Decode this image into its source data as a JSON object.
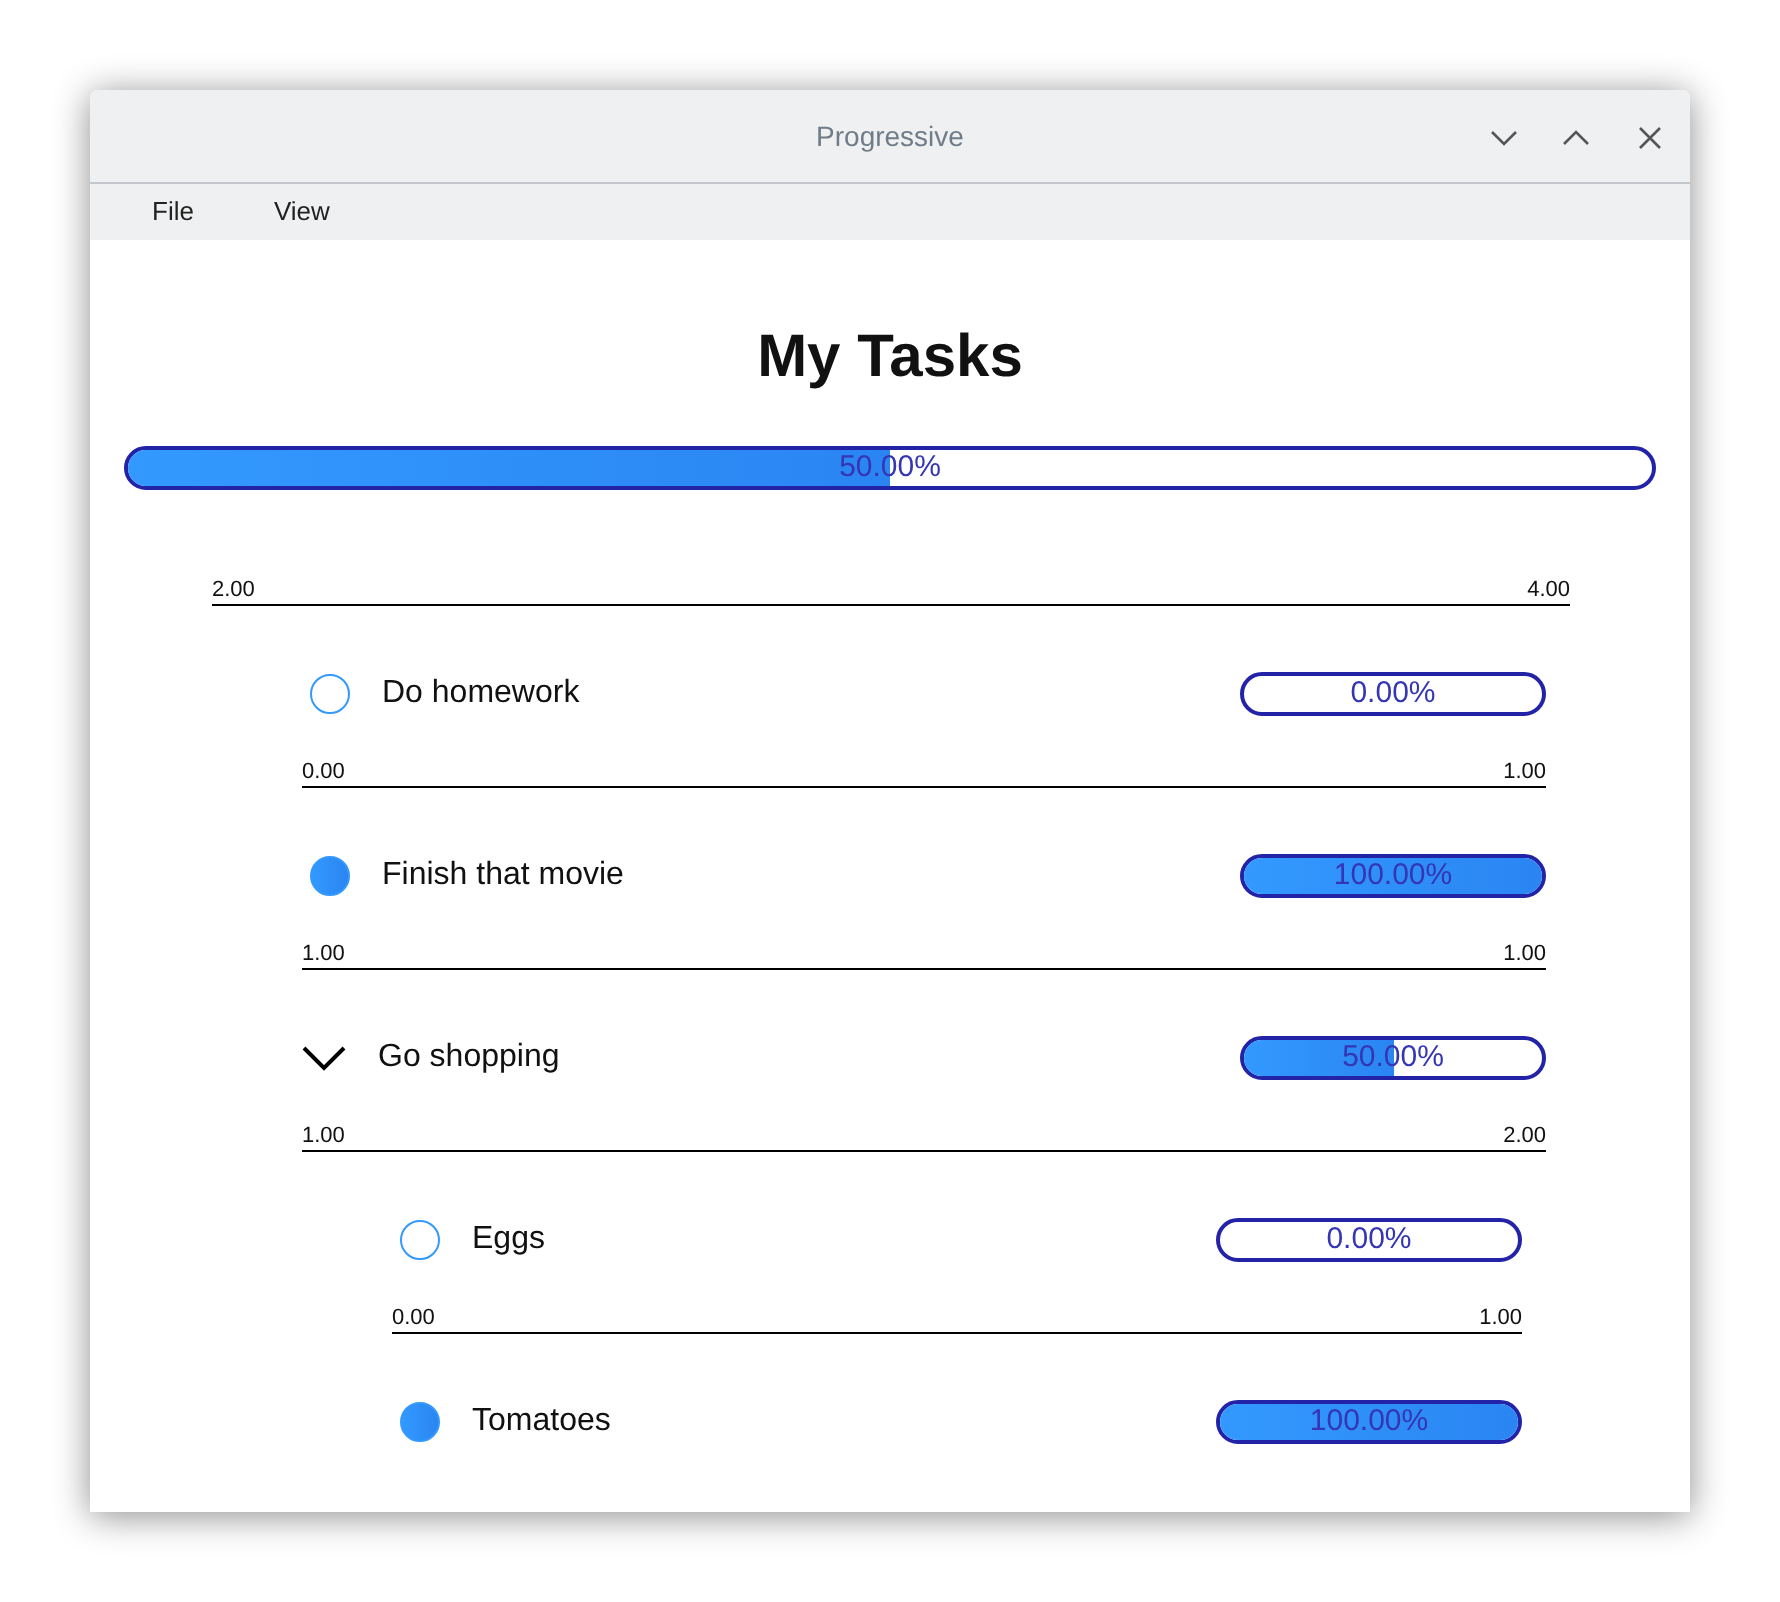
{
  "window": {
    "title": "Progressive"
  },
  "menu": [
    "File",
    "View"
  ],
  "heading": "My Tasks",
  "overall": {
    "level": 0.5,
    "reading": "50.00%",
    "range_start": "2.00",
    "range_end": "4.00"
  },
  "tasks": [
    {
      "kind": "task",
      "label": "Do homework",
      "checked": false,
      "level": 0,
      "reading": "0.00%",
      "range_start": "0.00",
      "range_end": "1.00"
    },
    {
      "kind": "task",
      "label": "Finish that movie",
      "checked": true,
      "level": 1,
      "reading": "100.00%",
      "range_start": "1.00",
      "range_end": "1.00"
    },
    {
      "kind": "group",
      "label": "Go shopping",
      "expanded": true,
      "level": 0.5,
      "reading": "50.00%",
      "range_start": "1.00",
      "range_end": "2.00",
      "children": [
        {
          "kind": "task",
          "label": "Eggs",
          "checked": false,
          "level": 0,
          "reading": "0.00%",
          "range_start": "0.00",
          "range_end": "1.00"
        },
        {
          "kind": "task",
          "label": "Tomatoes",
          "checked": true,
          "level": 1,
          "reading": "100.00%"
        }
      ]
    }
  ]
}
